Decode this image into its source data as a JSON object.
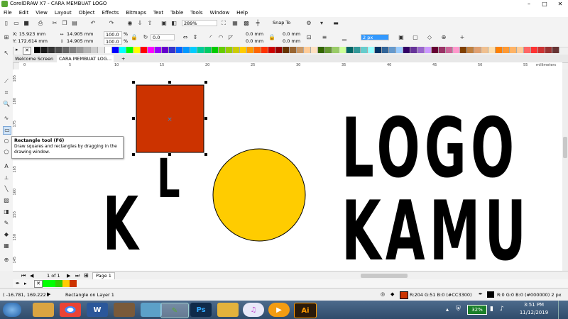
{
  "window": {
    "title": "CorelDRAW X7 - CARA MEMBUAT LOGO",
    "buttons": {
      "minimize": "–",
      "maximize": "□",
      "close": "✕"
    }
  },
  "menu": [
    "File",
    "Edit",
    "View",
    "Layout",
    "Object",
    "Effects",
    "Bitmaps",
    "Text",
    "Table",
    "Tools",
    "Window",
    "Help"
  ],
  "toolbar": {
    "zoom": "289%",
    "snap_to": "Snap To"
  },
  "propbar": {
    "x": "X: 15.923 mm",
    "y": "Y: 172.614 mm",
    "width": "14.905 mm",
    "height": "14.905 mm",
    "scale_w": "100.0",
    "scale_h": "100.0",
    "pct": "%",
    "rotation": "0.0",
    "corner_1": "0.0 mm",
    "corner_2": "0.0 mm",
    "corner_3": "0.0 mm",
    "corner_4": "0.0 mm",
    "outline": "2 px"
  },
  "tabs": {
    "welcome": "Welcome Screen",
    "document": "CARA MEMBUAT LOG...",
    "add": "+"
  },
  "ruler": {
    "units": "millimeters",
    "top": [
      "0",
      "5",
      "10",
      "15",
      "20",
      "25",
      "30",
      "35",
      "40",
      "45",
      "50",
      "55",
      "60"
    ],
    "left": [
      "185",
      "180",
      "175",
      "170",
      "165",
      "160",
      "155",
      "150",
      "145"
    ]
  },
  "canvas": {
    "letter_k": "K",
    "letter_l": "L",
    "logo_line1": "LOGO",
    "logo_line2": "KAMU",
    "center_marker": "×",
    "colors": {
      "rect_fill": "#CC3300",
      "circle_fill": "#FFCC00",
      "outline": "#000000"
    }
  },
  "tooltip": {
    "title": "Rectangle tool (F6)",
    "body": "Draw squares and rectangles by dragging in the drawing window."
  },
  "pagenav": {
    "counter": "1 of 1",
    "page_tab": "Page 1"
  },
  "statusbar": {
    "coords": "( -16.781, 169.222 )",
    "object": "Rectangle on Layer 1",
    "fill": "R:204 G:51 B:0 (#CC3300)",
    "outline": "R:0 G:0 B:0 (#000000)  2 px"
  },
  "taskbar": {
    "battery": "32%",
    "time": "3:51 PM",
    "date": "11/12/2019",
    "apps": [
      {
        "name": "start-button",
        "label": ""
      },
      {
        "name": "explorer",
        "label": ""
      },
      {
        "name": "chrome",
        "label": ""
      },
      {
        "name": "word",
        "label": "W"
      },
      {
        "name": "media",
        "label": ""
      },
      {
        "name": "app-blue",
        "label": ""
      },
      {
        "name": "coreldraw",
        "label": ""
      },
      {
        "name": "photoshop",
        "label": "Ps"
      },
      {
        "name": "folder",
        "label": ""
      },
      {
        "name": "itunes",
        "label": "♫"
      },
      {
        "name": "vlc",
        "label": "▶"
      },
      {
        "name": "illustrator",
        "label": "Ai"
      }
    ]
  },
  "palette_colors": [
    "#000000",
    "#1a1a1a",
    "#333333",
    "#4d4d4d",
    "#666666",
    "#808080",
    "#999999",
    "#b3b3b3",
    "#cccccc",
    "#e6e6e6",
    "#ffffff",
    "#0000ff",
    "#00ffff",
    "#00ff00",
    "#ffff00",
    "#ff0000",
    "#ff00ff",
    "#9900ff",
    "#6600cc",
    "#3333cc",
    "#0066ff",
    "#0099ff",
    "#00ccff",
    "#00cc99",
    "#00cc66",
    "#00cc00",
    "#66cc00",
    "#99cc00",
    "#cccc00",
    "#ffcc00",
    "#ff9900",
    "#ff6600",
    "#ff3300",
    "#cc0000",
    "#990000",
    "#663300",
    "#996633",
    "#cc9966",
    "#ffcc99",
    "#ffe0c0",
    "#336600",
    "#669933",
    "#99cc66",
    "#ccff99",
    "#006666",
    "#339999",
    "#66cccc",
    "#99ffff",
    "#003366",
    "#336699",
    "#6699cc",
    "#99ccff",
    "#330066",
    "#663399",
    "#9966cc",
    "#cc99ff",
    "#660033",
    "#993366",
    "#cc6699",
    "#ff99cc",
    "#804000",
    "#c08040",
    "#e0a070",
    "#f0c090",
    "#ffe0b0",
    "#ff8000",
    "#ff9933",
    "#ffb366",
    "#ffcc99",
    "#ff6666",
    "#ff3333",
    "#cc3333",
    "#993333",
    "#663333"
  ]
}
